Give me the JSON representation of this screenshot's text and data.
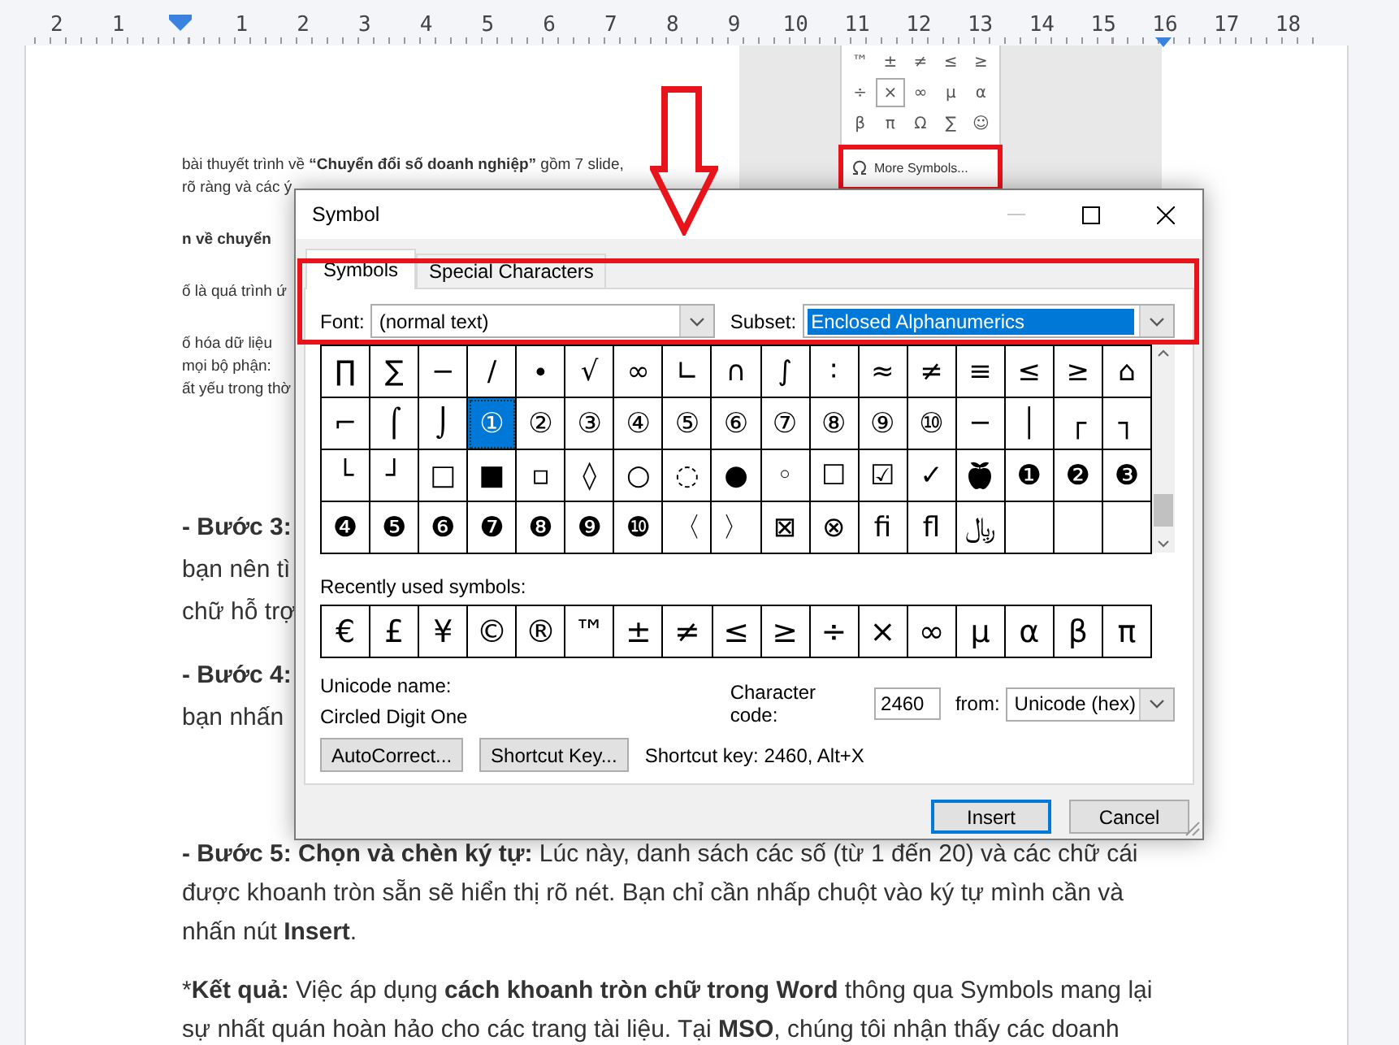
{
  "ruler": {
    "left_labels": [
      "2",
      "1"
    ],
    "right_labels": [
      "1",
      "2",
      "3",
      "4",
      "5",
      "6",
      "7",
      "8",
      "9",
      "10",
      "11",
      "12",
      "13",
      "14",
      "15",
      "16",
      "17",
      "18"
    ]
  },
  "embedded_screenshot": {
    "slide_paragraphs": [
      {
        "lines": [
          [
            {
              "text": "bài thuyết trình về "
            },
            {
              "text": "“Chuyển đổi số doanh nghiệp”",
              "bold": true
            },
            {
              "text": " gồm 7 slide,"
            }
          ],
          [
            {
              "text": "rõ ràng và các ý"
            }
          ]
        ]
      },
      {
        "lines": [
          [
            {
              "text": "n về chuyển",
              "bold": true
            }
          ]
        ]
      },
      {
        "lines": [
          [
            {
              "text": "ố là quá trình ứ"
            }
          ]
        ]
      },
      {
        "lines": [
          [
            {
              "text": "ố hóa dữ liệu"
            }
          ],
          [
            {
              "text": "mọi bộ phận:"
            }
          ],
          [
            {
              "text": "ất yếu trong thờ"
            }
          ]
        ]
      }
    ],
    "symbol_menu": {
      "rows": [
        [
          {
            "char": "™",
            "selected": false
          },
          {
            "char": "±",
            "selected": false
          },
          {
            "char": "≠",
            "selected": false
          },
          {
            "char": "≤",
            "selected": false
          },
          {
            "char": "≥",
            "selected": false
          }
        ],
        [
          {
            "char": "÷",
            "selected": false
          },
          {
            "char": "×",
            "selected": true
          },
          {
            "char": "∞",
            "selected": false
          },
          {
            "char": "µ",
            "selected": false
          },
          {
            "char": "α",
            "selected": false
          }
        ],
        [
          {
            "char": "β",
            "selected": false
          },
          {
            "char": "π",
            "selected": false
          },
          {
            "char": "Ω",
            "selected": false
          },
          {
            "char": "∑",
            "selected": false
          },
          {
            "char": "☺",
            "selected": false
          }
        ]
      ],
      "more_label": "More Symbols..."
    }
  },
  "document": {
    "paragraphs": [
      {
        "lines": [
          [
            {
              "text": "- Bước 3:",
              "bold": true
            }
          ],
          [
            {
              "text": "bạn nên tì"
            }
          ],
          [
            {
              "text": "chữ hỗ trợ"
            }
          ]
        ]
      },
      {
        "lines": [
          [
            {
              "text": "- Bước 4:",
              "bold": true
            }
          ],
          [
            {
              "text": "bạn nhấn"
            }
          ]
        ]
      },
      {
        "lines": [
          [
            {
              "text": "- Bước 5: Chọn và chèn ký tự:",
              "bold": true
            },
            {
              "text": " Lúc này, danh sách các số (từ 1 đến 20) và các chữ cái"
            }
          ],
          [
            {
              "text": "được khoanh tròn sẵn sẽ hiển thị rõ nét. Bạn chỉ cần nhấp chuột vào ký tự mình cần và"
            }
          ],
          [
            {
              "text": "nhấn nút "
            },
            {
              "text": "Insert",
              "bold": true
            },
            {
              "text": "."
            }
          ]
        ]
      },
      {
        "lines": [
          [
            {
              "text": "*"
            },
            {
              "text": "Kết quả:",
              "bold": true
            },
            {
              "text": " Việc áp dụng "
            },
            {
              "text": "cách khoanh tròn chữ trong Word",
              "bold": true
            },
            {
              "text": " thông qua Symbols mang lại"
            }
          ],
          [
            {
              "text": "sự nhất quán hoàn hảo cho các trang tài liệu. Tại "
            },
            {
              "text": "MSO",
              "bold": true
            },
            {
              "text": ", chúng tôi nhận thấy các doanh"
            }
          ]
        ]
      }
    ]
  },
  "symbol_dialog": {
    "title": "Symbol",
    "minimize_enabled": false,
    "tabs": [
      {
        "label": "Symbols",
        "selected": true
      },
      {
        "label": "Special Characters",
        "selected": false
      }
    ],
    "font": {
      "label": "Font:",
      "value": "(normal text)",
      "focused": false
    },
    "subset": {
      "label": "Subset:",
      "value": "Enclosed Alphanumerics",
      "focused": true
    },
    "symbol_grid": [
      [
        {
          "kind": "char",
          "char": "∏",
          "selected": false
        },
        {
          "kind": "char",
          "char": "∑",
          "selected": false
        },
        {
          "kind": "char",
          "char": "−",
          "selected": false
        },
        {
          "kind": "char",
          "char": "∕",
          "selected": false
        },
        {
          "kind": "char",
          "char": "∙",
          "selected": false
        },
        {
          "kind": "char",
          "char": "√",
          "selected": false
        },
        {
          "kind": "char",
          "char": "∞",
          "selected": false
        },
        {
          "kind": "char",
          "char": "∟",
          "selected": false
        },
        {
          "kind": "char",
          "char": "∩",
          "selected": false
        },
        {
          "kind": "char",
          "char": "∫",
          "selected": false
        },
        {
          "kind": "char",
          "char": "∶",
          "selected": false
        },
        {
          "kind": "char",
          "char": "≈",
          "selected": false
        },
        {
          "kind": "char",
          "char": "≠",
          "selected": false
        },
        {
          "kind": "char",
          "char": "≡",
          "selected": false
        },
        {
          "kind": "char",
          "char": "≤",
          "selected": false
        },
        {
          "kind": "char",
          "char": "≥",
          "selected": false
        },
        {
          "kind": "char",
          "char": "⌂",
          "selected": false
        }
      ],
      [
        {
          "kind": "char",
          "char": "⌐",
          "selected": false
        },
        {
          "kind": "char",
          "char": "⌠",
          "selected": false
        },
        {
          "kind": "char",
          "char": "⌡",
          "selected": false
        },
        {
          "kind": "char",
          "char": "①",
          "selected": true
        },
        {
          "kind": "char",
          "char": "②",
          "selected": false
        },
        {
          "kind": "char",
          "char": "③",
          "selected": false
        },
        {
          "kind": "char",
          "char": "④",
          "selected": false
        },
        {
          "kind": "char",
          "char": "⑤",
          "selected": false
        },
        {
          "kind": "char",
          "char": "⑥",
          "selected": false
        },
        {
          "kind": "char",
          "char": "⑦",
          "selected": false
        },
        {
          "kind": "char",
          "char": "⑧",
          "selected": false
        },
        {
          "kind": "char",
          "char": "⑨",
          "selected": false
        },
        {
          "kind": "char",
          "char": "⑩",
          "selected": false
        },
        {
          "kind": "char",
          "char": "─",
          "selected": false
        },
        {
          "kind": "char",
          "char": "│",
          "selected": false
        },
        {
          "kind": "char",
          "char": "┌",
          "selected": false
        },
        {
          "kind": "char",
          "char": "┐",
          "selected": false
        }
      ],
      [
        {
          "kind": "char",
          "char": "└",
          "selected": false
        },
        {
          "kind": "char",
          "char": "┘",
          "selected": false
        },
        {
          "kind": "char",
          "char": "□",
          "selected": false
        },
        {
          "kind": "char",
          "char": "■",
          "selected": false
        },
        {
          "kind": "char",
          "char": "▫",
          "selected": false
        },
        {
          "kind": "char",
          "char": "◊",
          "selected": false
        },
        {
          "kind": "char",
          "char": "○",
          "selected": false
        },
        {
          "kind": "char",
          "char": "◌",
          "selected": false
        },
        {
          "kind": "char",
          "char": "●",
          "selected": false
        },
        {
          "kind": "char",
          "char": "◦",
          "selected": false
        },
        {
          "kind": "char",
          "char": "☐",
          "selected": false
        },
        {
          "kind": "char",
          "char": "☑",
          "selected": false
        },
        {
          "kind": "char",
          "char": "✓",
          "selected": false
        },
        {
          "kind": "icon",
          "selected": false
        },
        {
          "kind": "char",
          "char": "❶",
          "selected": false
        },
        {
          "kind": "char",
          "char": "❷",
          "selected": false
        },
        {
          "kind": "char",
          "char": "❸",
          "selected": false
        }
      ],
      [
        {
          "kind": "char",
          "char": "❹",
          "selected": false
        },
        {
          "kind": "char",
          "char": "❺",
          "selected": false
        },
        {
          "kind": "char",
          "char": "❻",
          "selected": false
        },
        {
          "kind": "char",
          "char": "❼",
          "selected": false
        },
        {
          "kind": "char",
          "char": "❽",
          "selected": false
        },
        {
          "kind": "char",
          "char": "❾",
          "selected": false
        },
        {
          "kind": "char",
          "char": "❿",
          "selected": false
        },
        {
          "kind": "char",
          "char": "〈",
          "selected": false
        },
        {
          "kind": "char",
          "char": "〉",
          "selected": false
        },
        {
          "kind": "char",
          "char": "⊠",
          "selected": false
        },
        {
          "kind": "char",
          "char": "⊗",
          "selected": false
        },
        {
          "kind": "char",
          "char": "ﬁ",
          "selected": false
        },
        {
          "kind": "char",
          "char": "ﬂ",
          "selected": false
        },
        {
          "kind": "char",
          "char": "﷼",
          "selected": false
        }
      ]
    ],
    "recent_label": "Recently used symbols:",
    "recent_symbols": [
      {
        "char": "€",
        "selected": false
      },
      {
        "char": "£",
        "selected": false
      },
      {
        "char": "¥",
        "selected": false
      },
      {
        "char": "©",
        "selected": false
      },
      {
        "char": "®",
        "selected": false
      },
      {
        "char": "™",
        "selected": false
      },
      {
        "char": "±",
        "selected": false
      },
      {
        "char": "≠",
        "selected": false
      },
      {
        "char": "≤",
        "selected": false
      },
      {
        "char": "≥",
        "selected": false
      },
      {
        "char": "÷",
        "selected": false
      },
      {
        "char": "×",
        "selected": false
      },
      {
        "char": "∞",
        "selected": false
      },
      {
        "char": "μ",
        "selected": false
      },
      {
        "char": "α",
        "selected": false
      },
      {
        "char": "β",
        "selected": false
      },
      {
        "char": "π",
        "selected": false
      }
    ],
    "unicode_name_label": "Unicode name:",
    "unicode_name": "Circled Digit One",
    "character_code": {
      "label": "Character code:",
      "value": "2460"
    },
    "from": {
      "label": "from:",
      "value": "Unicode (hex)"
    },
    "buttons": [
      {
        "label": "AutoCorrect..."
      },
      {
        "label": "Shortcut Key..."
      }
    ],
    "shortcut_text": "Shortcut key: 2460, Alt+X",
    "footer_buttons": [
      {
        "label": "Insert",
        "default": true
      },
      {
        "label": "Cancel",
        "default": false
      }
    ]
  }
}
